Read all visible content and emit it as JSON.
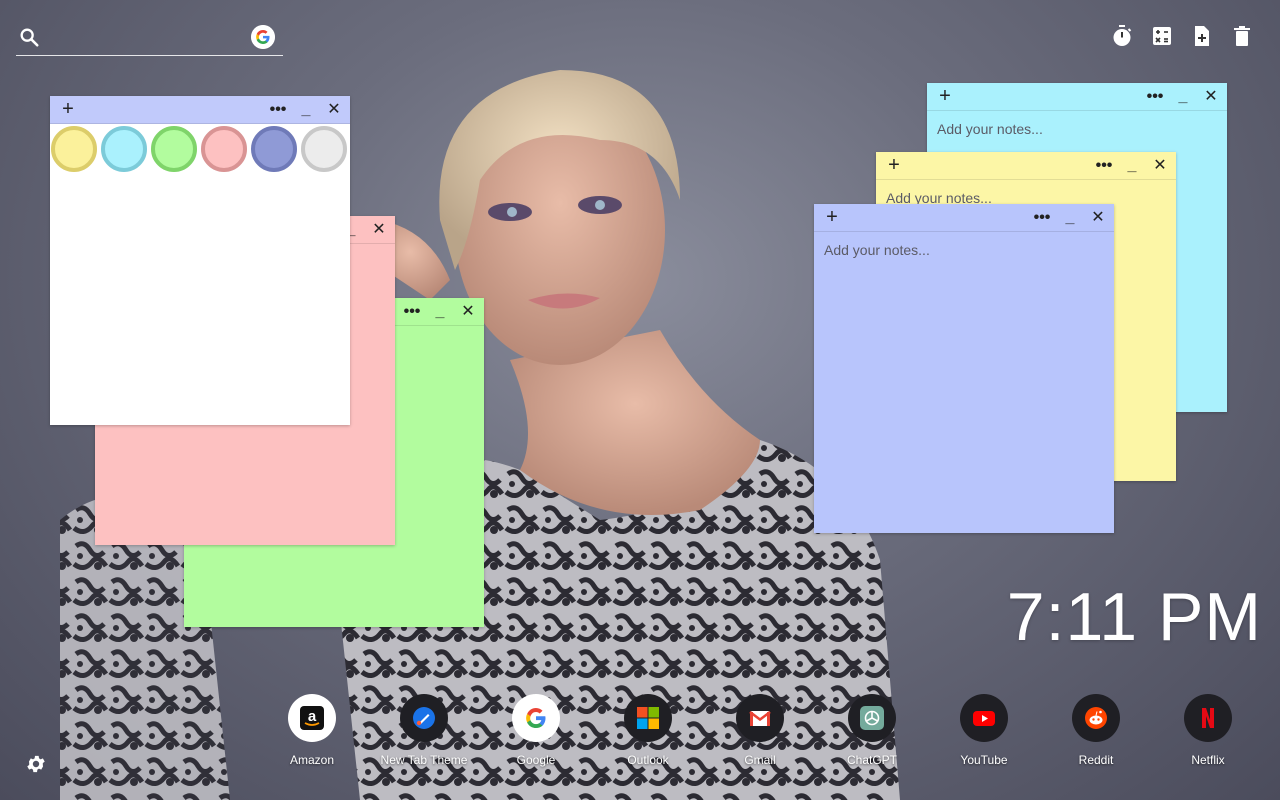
{
  "search": {
    "placeholder": "",
    "engine_icon": "google-icon"
  },
  "toolbar": {
    "items": [
      "timer-icon",
      "calculator-icon",
      "new-note-icon",
      "trash-icon"
    ]
  },
  "notes": {
    "placeholder": "Add your notes...",
    "plus": "+",
    "more": "•••",
    "minimize": "_",
    "close": "✕",
    "colors": {
      "white": "#ffffff",
      "pink": "#fdc1c1",
      "green": "#b2fc9e",
      "cyan": "#aaf1fd",
      "yellow": "#fcf6a6",
      "blue": "#b8c5fc"
    },
    "swatches": [
      {
        "fill": "#fbf19b",
        "ring": "#dccd6a"
      },
      {
        "fill": "#aaf1fd",
        "ring": "#7ccbd9"
      },
      {
        "fill": "#b2fc9e",
        "ring": "#7fd46a"
      },
      {
        "fill": "#fdc1c1",
        "ring": "#d99494"
      },
      {
        "fill": "#8f9ad6",
        "ring": "#6f7ab8"
      },
      {
        "fill": "#ececec",
        "ring": "#c8c8c8"
      }
    ]
  },
  "clock": {
    "time": "7:11 PM"
  },
  "shortcuts": [
    {
      "label": "Amazon",
      "icon": "amazon-icon"
    },
    {
      "label": "New Tab Theme",
      "icon": "new-tab-theme-icon"
    },
    {
      "label": "Google",
      "icon": "google-icon"
    },
    {
      "label": "Outlook",
      "icon": "microsoft-icon"
    },
    {
      "label": "Gmail",
      "icon": "gmail-icon"
    },
    {
      "label": "ChatGPT",
      "icon": "chatgpt-icon"
    },
    {
      "label": "YouTube",
      "icon": "youtube-icon"
    },
    {
      "label": "Reddit",
      "icon": "reddit-icon"
    },
    {
      "label": "Netflix",
      "icon": "netflix-icon"
    }
  ],
  "settings": {
    "icon": "gear-icon"
  }
}
